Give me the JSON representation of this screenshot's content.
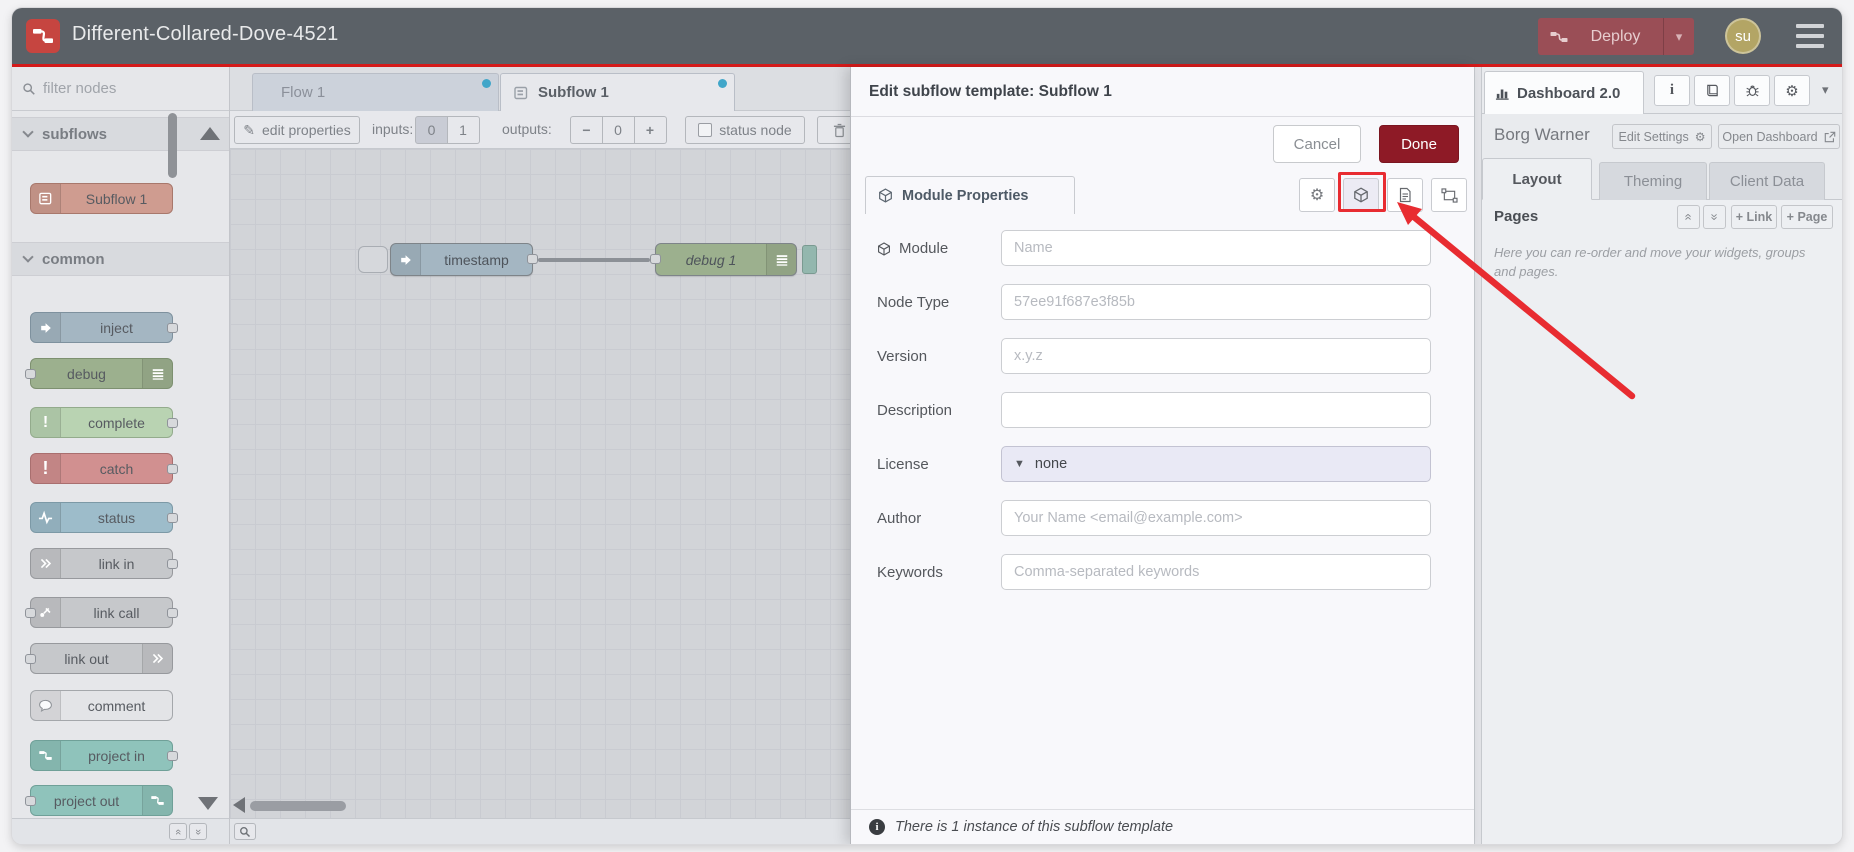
{
  "header": {
    "title": "Different-Collared-Dove-4521",
    "deploy_label": "Deploy",
    "avatar_initials": "su"
  },
  "palette": {
    "filter_placeholder": "filter nodes",
    "sections": [
      {
        "label": "subflows",
        "items": [
          {
            "label": "Subflow 1"
          }
        ]
      },
      {
        "label": "common",
        "items": [
          {
            "label": "inject"
          },
          {
            "label": "debug"
          },
          {
            "label": "complete"
          },
          {
            "label": "catch"
          },
          {
            "label": "status"
          },
          {
            "label": "link in"
          },
          {
            "label": "link call"
          },
          {
            "label": "link out"
          },
          {
            "label": "comment"
          },
          {
            "label": "project in"
          },
          {
            "label": "project out"
          }
        ]
      }
    ]
  },
  "tabs": [
    {
      "label": "Flow 1"
    },
    {
      "label": "Subflow 1"
    }
  ],
  "toolbar": {
    "edit_properties": "edit properties",
    "inputs_label": "inputs:",
    "input_options": [
      "0",
      "1"
    ],
    "outputs_label": "outputs:",
    "minus": "−",
    "outputs_value": "0",
    "plus": "+",
    "status_node": "status node"
  },
  "canvas": {
    "nodes": [
      {
        "label": "timestamp"
      },
      {
        "label": "debug 1"
      }
    ]
  },
  "tray": {
    "title": "Edit subflow template: Subflow 1",
    "cancel": "Cancel",
    "done": "Done",
    "properties_tab": "Module Properties",
    "fields": [
      {
        "label": "Module",
        "placeholder": "Name"
      },
      {
        "label": "Node Type",
        "placeholder": "57ee91f687e3f85b"
      },
      {
        "label": "Version",
        "placeholder": "x.y.z"
      },
      {
        "label": "Description",
        "placeholder": ""
      },
      {
        "label": "License",
        "value": "none"
      },
      {
        "label": "Author",
        "placeholder": "Your Name <email@example.com>"
      },
      {
        "label": "Keywords",
        "placeholder": "Comma-separated keywords"
      }
    ],
    "footer_note": "There is 1 instance of this subflow template"
  },
  "sidebar": {
    "dashboard_tab": "Dashboard 2.0",
    "project_name": "Borg Warner",
    "edit_settings": "Edit Settings",
    "open_dashboard": "Open Dashboard",
    "tabs": [
      {
        "label": "Layout"
      },
      {
        "label": "Theming"
      },
      {
        "label": "Client Data"
      }
    ],
    "pages_title": "Pages",
    "link_button": "+ Link",
    "page_button": "+ Page",
    "help_text": "Here you can re-order and move your widgets, groups and pages."
  },
  "icons": {
    "gear": "⚙",
    "pencil": "✎",
    "caret_down": "▾",
    "double_chevron": "«",
    "info": "i",
    "minus": "−",
    "plus": "+"
  },
  "colors": {
    "header_bg": "#5b6167",
    "accent_red_line": "#d41a1a",
    "annotation_red": "#e82c31",
    "deploy_bg": "#9a4e56",
    "done_bg": "#8e1a26",
    "avatar_bg": "#b3a565",
    "blue_dot": "#41a6c9",
    "canvas_bg": "#d2d4d8"
  }
}
